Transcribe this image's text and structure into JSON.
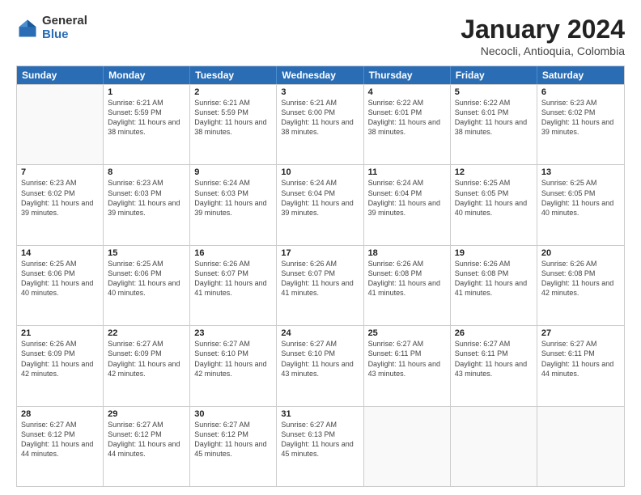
{
  "logo": {
    "general": "General",
    "blue": "Blue"
  },
  "title": "January 2024",
  "subtitle": "Necocli, Antioquia, Colombia",
  "header_days": [
    "Sunday",
    "Monday",
    "Tuesday",
    "Wednesday",
    "Thursday",
    "Friday",
    "Saturday"
  ],
  "weeks": [
    [
      {
        "day": "",
        "sunrise": "",
        "sunset": "",
        "daylight": ""
      },
      {
        "day": "1",
        "sunrise": "Sunrise: 6:21 AM",
        "sunset": "Sunset: 5:59 PM",
        "daylight": "Daylight: 11 hours and 38 minutes."
      },
      {
        "day": "2",
        "sunrise": "Sunrise: 6:21 AM",
        "sunset": "Sunset: 5:59 PM",
        "daylight": "Daylight: 11 hours and 38 minutes."
      },
      {
        "day": "3",
        "sunrise": "Sunrise: 6:21 AM",
        "sunset": "Sunset: 6:00 PM",
        "daylight": "Daylight: 11 hours and 38 minutes."
      },
      {
        "day": "4",
        "sunrise": "Sunrise: 6:22 AM",
        "sunset": "Sunset: 6:01 PM",
        "daylight": "Daylight: 11 hours and 38 minutes."
      },
      {
        "day": "5",
        "sunrise": "Sunrise: 6:22 AM",
        "sunset": "Sunset: 6:01 PM",
        "daylight": "Daylight: 11 hours and 38 minutes."
      },
      {
        "day": "6",
        "sunrise": "Sunrise: 6:23 AM",
        "sunset": "Sunset: 6:02 PM",
        "daylight": "Daylight: 11 hours and 39 minutes."
      }
    ],
    [
      {
        "day": "7",
        "sunrise": "Sunrise: 6:23 AM",
        "sunset": "Sunset: 6:02 PM",
        "daylight": "Daylight: 11 hours and 39 minutes."
      },
      {
        "day": "8",
        "sunrise": "Sunrise: 6:23 AM",
        "sunset": "Sunset: 6:03 PM",
        "daylight": "Daylight: 11 hours and 39 minutes."
      },
      {
        "day": "9",
        "sunrise": "Sunrise: 6:24 AM",
        "sunset": "Sunset: 6:03 PM",
        "daylight": "Daylight: 11 hours and 39 minutes."
      },
      {
        "day": "10",
        "sunrise": "Sunrise: 6:24 AM",
        "sunset": "Sunset: 6:04 PM",
        "daylight": "Daylight: 11 hours and 39 minutes."
      },
      {
        "day": "11",
        "sunrise": "Sunrise: 6:24 AM",
        "sunset": "Sunset: 6:04 PM",
        "daylight": "Daylight: 11 hours and 39 minutes."
      },
      {
        "day": "12",
        "sunrise": "Sunrise: 6:25 AM",
        "sunset": "Sunset: 6:05 PM",
        "daylight": "Daylight: 11 hours and 40 minutes."
      },
      {
        "day": "13",
        "sunrise": "Sunrise: 6:25 AM",
        "sunset": "Sunset: 6:05 PM",
        "daylight": "Daylight: 11 hours and 40 minutes."
      }
    ],
    [
      {
        "day": "14",
        "sunrise": "Sunrise: 6:25 AM",
        "sunset": "Sunset: 6:06 PM",
        "daylight": "Daylight: 11 hours and 40 minutes."
      },
      {
        "day": "15",
        "sunrise": "Sunrise: 6:25 AM",
        "sunset": "Sunset: 6:06 PM",
        "daylight": "Daylight: 11 hours and 40 minutes."
      },
      {
        "day": "16",
        "sunrise": "Sunrise: 6:26 AM",
        "sunset": "Sunset: 6:07 PM",
        "daylight": "Daylight: 11 hours and 41 minutes."
      },
      {
        "day": "17",
        "sunrise": "Sunrise: 6:26 AM",
        "sunset": "Sunset: 6:07 PM",
        "daylight": "Daylight: 11 hours and 41 minutes."
      },
      {
        "day": "18",
        "sunrise": "Sunrise: 6:26 AM",
        "sunset": "Sunset: 6:08 PM",
        "daylight": "Daylight: 11 hours and 41 minutes."
      },
      {
        "day": "19",
        "sunrise": "Sunrise: 6:26 AM",
        "sunset": "Sunset: 6:08 PM",
        "daylight": "Daylight: 11 hours and 41 minutes."
      },
      {
        "day": "20",
        "sunrise": "Sunrise: 6:26 AM",
        "sunset": "Sunset: 6:08 PM",
        "daylight": "Daylight: 11 hours and 42 minutes."
      }
    ],
    [
      {
        "day": "21",
        "sunrise": "Sunrise: 6:26 AM",
        "sunset": "Sunset: 6:09 PM",
        "daylight": "Daylight: 11 hours and 42 minutes."
      },
      {
        "day": "22",
        "sunrise": "Sunrise: 6:27 AM",
        "sunset": "Sunset: 6:09 PM",
        "daylight": "Daylight: 11 hours and 42 minutes."
      },
      {
        "day": "23",
        "sunrise": "Sunrise: 6:27 AM",
        "sunset": "Sunset: 6:10 PM",
        "daylight": "Daylight: 11 hours and 42 minutes."
      },
      {
        "day": "24",
        "sunrise": "Sunrise: 6:27 AM",
        "sunset": "Sunset: 6:10 PM",
        "daylight": "Daylight: 11 hours and 43 minutes."
      },
      {
        "day": "25",
        "sunrise": "Sunrise: 6:27 AM",
        "sunset": "Sunset: 6:11 PM",
        "daylight": "Daylight: 11 hours and 43 minutes."
      },
      {
        "day": "26",
        "sunrise": "Sunrise: 6:27 AM",
        "sunset": "Sunset: 6:11 PM",
        "daylight": "Daylight: 11 hours and 43 minutes."
      },
      {
        "day": "27",
        "sunrise": "Sunrise: 6:27 AM",
        "sunset": "Sunset: 6:11 PM",
        "daylight": "Daylight: 11 hours and 44 minutes."
      }
    ],
    [
      {
        "day": "28",
        "sunrise": "Sunrise: 6:27 AM",
        "sunset": "Sunset: 6:12 PM",
        "daylight": "Daylight: 11 hours and 44 minutes."
      },
      {
        "day": "29",
        "sunrise": "Sunrise: 6:27 AM",
        "sunset": "Sunset: 6:12 PM",
        "daylight": "Daylight: 11 hours and 44 minutes."
      },
      {
        "day": "30",
        "sunrise": "Sunrise: 6:27 AM",
        "sunset": "Sunset: 6:12 PM",
        "daylight": "Daylight: 11 hours and 45 minutes."
      },
      {
        "day": "31",
        "sunrise": "Sunrise: 6:27 AM",
        "sunset": "Sunset: 6:13 PM",
        "daylight": "Daylight: 11 hours and 45 minutes."
      },
      {
        "day": "",
        "sunrise": "",
        "sunset": "",
        "daylight": ""
      },
      {
        "day": "",
        "sunrise": "",
        "sunset": "",
        "daylight": ""
      },
      {
        "day": "",
        "sunrise": "",
        "sunset": "",
        "daylight": ""
      }
    ]
  ]
}
